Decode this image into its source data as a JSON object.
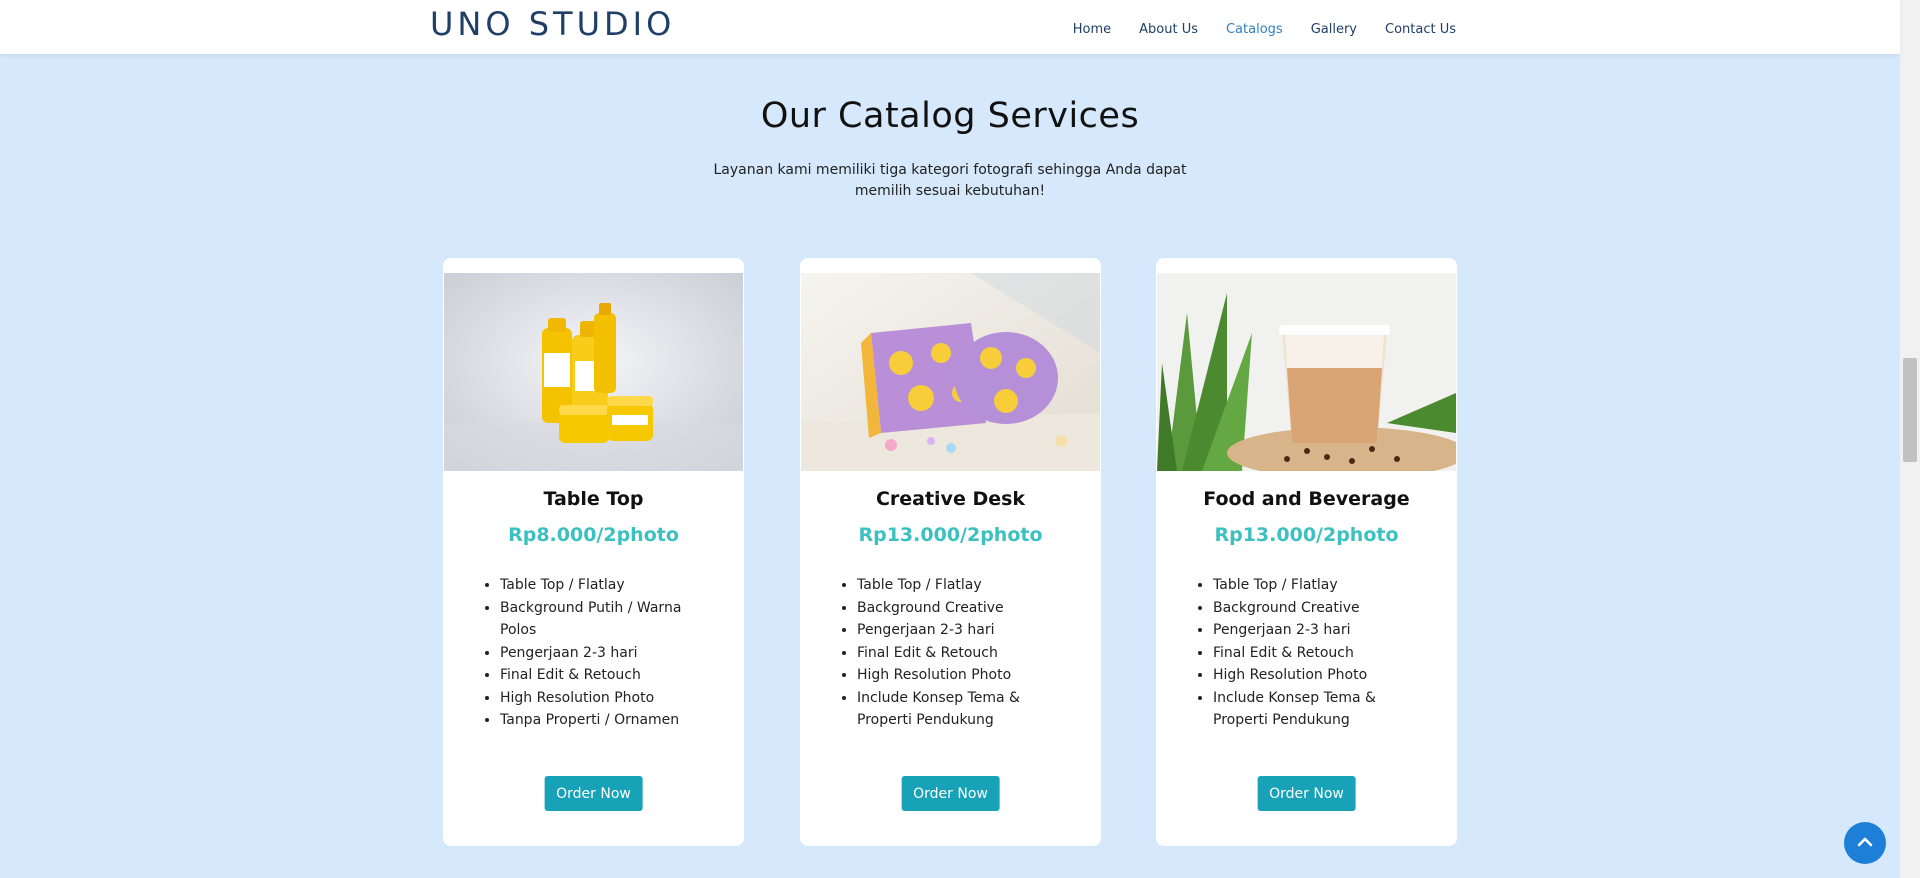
{
  "nav": {
    "brand": "UNO STUDIO",
    "links": [
      {
        "label": "Home"
      },
      {
        "label": "About Us"
      },
      {
        "label": "Catalogs"
      },
      {
        "label": "Gallery"
      },
      {
        "label": "Contact Us"
      }
    ],
    "active": "Catalogs"
  },
  "section": {
    "title": "Our Catalog Services",
    "description": "Layanan kami memiliki tiga kategori fotografi sehingga Anda dapat memilih sesuai kebutuhan!"
  },
  "cards": [
    {
      "title": "Table Top",
      "price": "Rp8.000/2photo",
      "features": [
        "Table Top / Flatlay",
        "Background Putih / Warna Polos",
        "Pengerjaan 2-3 hari",
        "Final Edit & Retouch",
        "High Resolution Photo",
        "Tanpa Properti / Ornamen"
      ],
      "button": "Order Now"
    },
    {
      "title": "Creative Desk",
      "price": "Rp13.000/2photo",
      "features": [
        "Table Top / Flatlay",
        "Background Creative",
        "Pengerjaan 2-3 hari",
        "Final Edit & Retouch",
        "High Resolution Photo",
        "Include Konsep Tema & Properti Pendukung"
      ],
      "button": "Order Now"
    },
    {
      "title": "Food and Beverage",
      "price": "Rp13.000/2photo",
      "features": [
        "Table Top / Flatlay",
        "Background Creative",
        "Pengerjaan 2-3 hari",
        "Final Edit & Retouch",
        "High Resolution Photo",
        "Include Konsep Tema & Properti Pendukung"
      ],
      "button": "Order Now"
    }
  ],
  "colors": {
    "page_background": "#d6e8fc",
    "brand": "#1f3f66",
    "price": "#3cc0c0",
    "button": "#17a2b8",
    "back_to_top": "#1e7fd8"
  },
  "icons": {
    "back_to_top": "chevron-up-icon"
  }
}
